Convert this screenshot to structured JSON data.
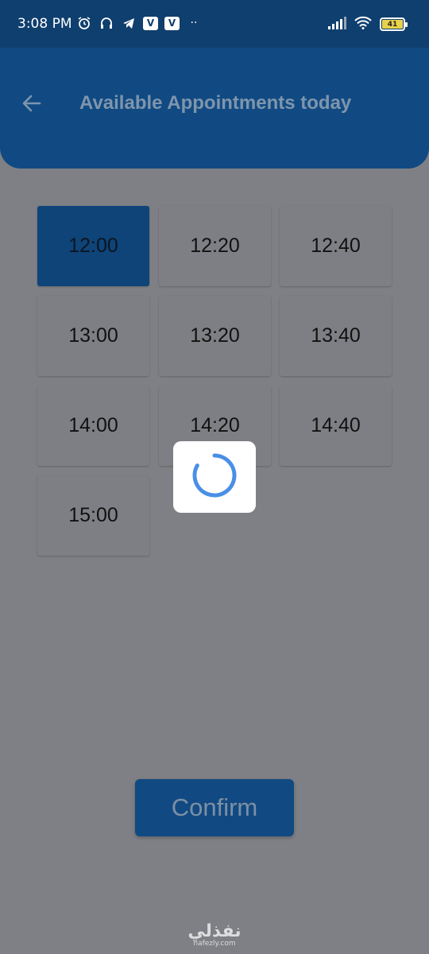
{
  "status_bar": {
    "time": "3:08 PM",
    "left_icons": [
      "alarm-icon",
      "headphones-icon",
      "telegram-icon",
      "v-app-icon",
      "v-app-icon",
      "more-dots-icon"
    ],
    "v_letter": "V",
    "dots": "··",
    "battery_level": "41",
    "right_icons": [
      "signal-icon",
      "wifi-icon",
      "battery-icon"
    ]
  },
  "app_bar": {
    "back_icon": "arrow-left-icon",
    "title": "Available Appointments today"
  },
  "slots": [
    {
      "time": "12:00",
      "selected": true
    },
    {
      "time": "12:20",
      "selected": false
    },
    {
      "time": "12:40",
      "selected": false
    },
    {
      "time": "13:00",
      "selected": false
    },
    {
      "time": "13:20",
      "selected": false
    },
    {
      "time": "13:40",
      "selected": false
    },
    {
      "time": "14:00",
      "selected": false
    },
    {
      "time": "14:20",
      "selected": false
    },
    {
      "time": "14:40",
      "selected": false
    },
    {
      "time": "15:00",
      "selected": false
    }
  ],
  "loading": {
    "icon": "spinner-icon",
    "color": "#4a8fe6"
  },
  "confirm_button": {
    "label": "Confirm"
  },
  "watermark": {
    "arabic": "نفذلي",
    "latin": "nafezly.com"
  },
  "colors": {
    "primary": "#114a82",
    "overlay_bg": "#7f8085",
    "spinner": "#4a8fe6"
  }
}
